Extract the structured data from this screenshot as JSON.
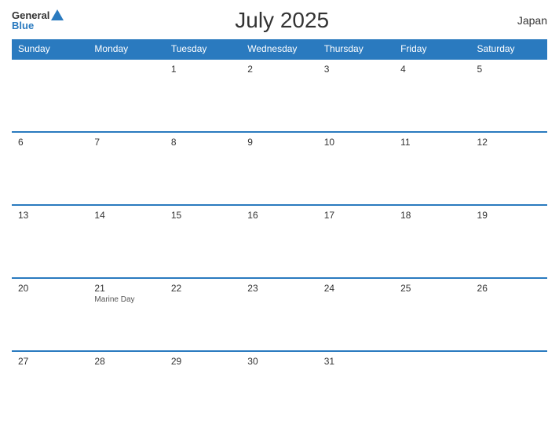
{
  "header": {
    "logo": {
      "general": "General",
      "blue": "Blue",
      "triangle": true
    },
    "title": "July 2025",
    "country": "Japan"
  },
  "calendar": {
    "columns": [
      "Sunday",
      "Monday",
      "Tuesday",
      "Wednesday",
      "Thursday",
      "Friday",
      "Saturday"
    ],
    "weeks": [
      [
        {
          "date": "",
          "holiday": ""
        },
        {
          "date": "",
          "holiday": ""
        },
        {
          "date": "1",
          "holiday": ""
        },
        {
          "date": "2",
          "holiday": ""
        },
        {
          "date": "3",
          "holiday": ""
        },
        {
          "date": "4",
          "holiday": ""
        },
        {
          "date": "5",
          "holiday": ""
        }
      ],
      [
        {
          "date": "6",
          "holiday": ""
        },
        {
          "date": "7",
          "holiday": ""
        },
        {
          "date": "8",
          "holiday": ""
        },
        {
          "date": "9",
          "holiday": ""
        },
        {
          "date": "10",
          "holiday": ""
        },
        {
          "date": "11",
          "holiday": ""
        },
        {
          "date": "12",
          "holiday": ""
        }
      ],
      [
        {
          "date": "13",
          "holiday": ""
        },
        {
          "date": "14",
          "holiday": ""
        },
        {
          "date": "15",
          "holiday": ""
        },
        {
          "date": "16",
          "holiday": ""
        },
        {
          "date": "17",
          "holiday": ""
        },
        {
          "date": "18",
          "holiday": ""
        },
        {
          "date": "19",
          "holiday": ""
        }
      ],
      [
        {
          "date": "20",
          "holiday": ""
        },
        {
          "date": "21",
          "holiday": "Marine Day"
        },
        {
          "date": "22",
          "holiday": ""
        },
        {
          "date": "23",
          "holiday": ""
        },
        {
          "date": "24",
          "holiday": ""
        },
        {
          "date": "25",
          "holiday": ""
        },
        {
          "date": "26",
          "holiday": ""
        }
      ],
      [
        {
          "date": "27",
          "holiday": ""
        },
        {
          "date": "28",
          "holiday": ""
        },
        {
          "date": "29",
          "holiday": ""
        },
        {
          "date": "30",
          "holiday": ""
        },
        {
          "date": "31",
          "holiday": ""
        },
        {
          "date": "",
          "holiday": ""
        },
        {
          "date": "",
          "holiday": ""
        }
      ]
    ]
  }
}
